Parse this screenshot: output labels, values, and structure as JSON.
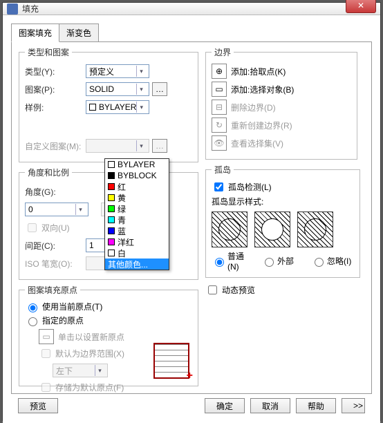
{
  "window": {
    "title": "填充"
  },
  "tabs": {
    "pattern": "图案填充",
    "gradient": "渐变色"
  },
  "type_pattern": {
    "legend": "类型和图案",
    "type_label": "类型(Y):",
    "type_value": "预定义",
    "pattern_label": "图案(P):",
    "pattern_value": "SOLID",
    "sample_label": "样例:",
    "sample_value": "BYLAYER",
    "custom_label": "自定义图案(M):"
  },
  "dropdown": {
    "opts": [
      {
        "label": "BYLAYER",
        "color": "#ffffff"
      },
      {
        "label": "BYBLOCK",
        "color": "#000000"
      },
      {
        "label": "红",
        "color": "#ff0000"
      },
      {
        "label": "黄",
        "color": "#ffff00"
      },
      {
        "label": "绿",
        "color": "#00ff00"
      },
      {
        "label": "青",
        "color": "#00ffff"
      },
      {
        "label": "蓝",
        "color": "#0000ff"
      },
      {
        "label": "洋红",
        "color": "#ff00ff"
      },
      {
        "label": "白",
        "color": "#ffffff"
      }
    ],
    "more": "其他颜色..."
  },
  "angle_scale": {
    "legend": "角度和比例",
    "angle_label": "角度(G):",
    "angle_value": "0",
    "double_label": "双向(U)",
    "spacing_label": "间距(C):",
    "spacing_value": "1",
    "iso_label": "ISO 笔宽(O):"
  },
  "origin": {
    "legend": "图案填充原点",
    "use_current": "使用当前原点(T)",
    "specify": "指定的原点",
    "click_set": "单击以设置新原点",
    "default_extent": "默认为边界范围(X)",
    "extent_value": "左下",
    "store_default": "存储为默认原点(F)"
  },
  "boundary": {
    "legend": "边界",
    "add_pick": "添加:拾取点(K)",
    "add_select": "添加:选择对象(B)",
    "remove": "删除边界(D)",
    "recreate": "重新创建边界(R)",
    "view_sel": "查看选择集(V)"
  },
  "islands": {
    "legend": "孤岛",
    "detect": "孤岛检测(L)",
    "style_label": "孤岛显示样式:",
    "normal": "普通(N)",
    "outer": "外部",
    "ignore": "忽略(I)"
  },
  "dynamic_preview": "动态预览",
  "buttons": {
    "preview": "预览",
    "ok": "确定",
    "cancel": "取消",
    "help": "帮助",
    "expand": ">>"
  }
}
